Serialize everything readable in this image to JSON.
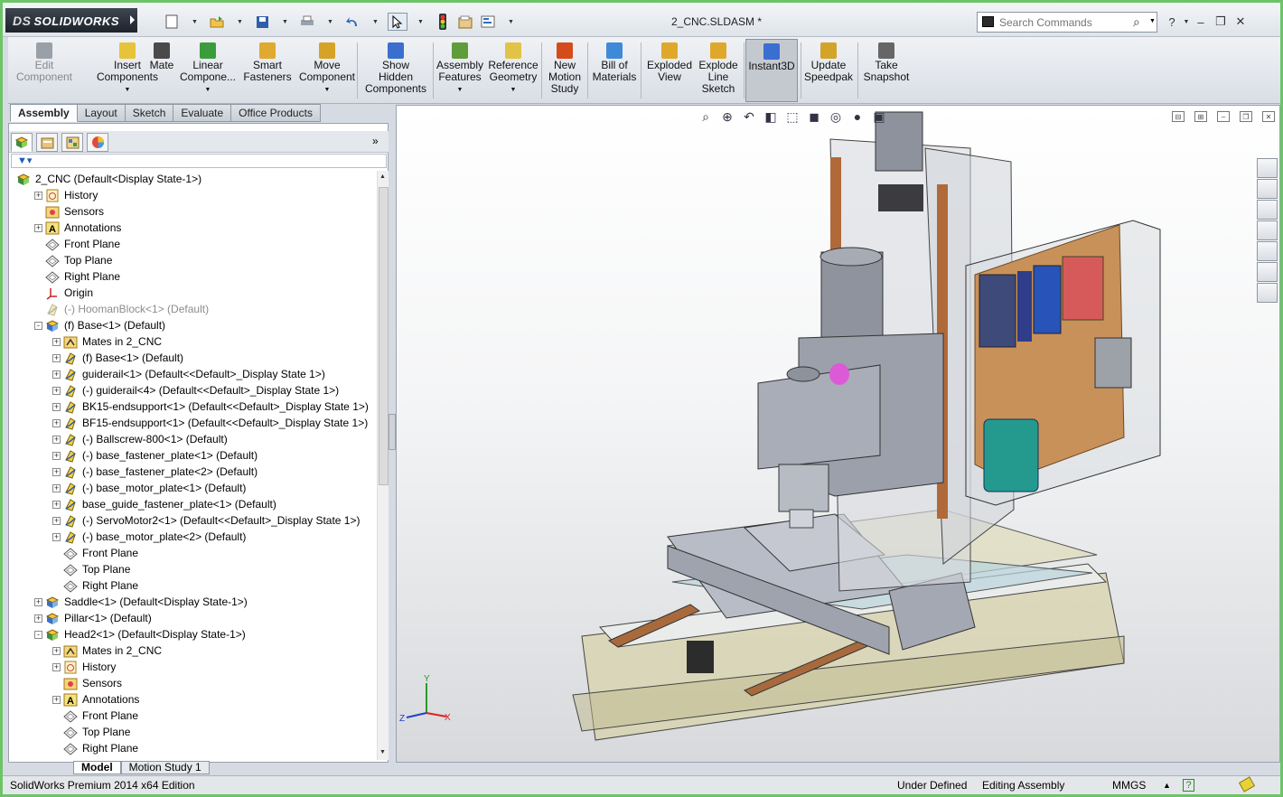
{
  "app": {
    "brand": "SOLIDWORKS",
    "doc_title": "2_CNC.SLDASM *"
  },
  "search": {
    "placeholder": "Search Commands"
  },
  "quick_access": [
    "new-icon",
    "open-icon",
    "save-icon",
    "print-icon",
    "undo-icon",
    "select-icon",
    "rebuild-icon",
    "file-properties-icon",
    "options-icon"
  ],
  "commands": [
    {
      "label": "Edit\nComponent",
      "icon": "edit-component-icon",
      "disabled": true
    },
    {
      "label": "Insert\nComponents",
      "icon": "insert-components-icon"
    },
    {
      "label": "Mate",
      "icon": "mate-icon"
    },
    {
      "label": "Linear\nCompone...",
      "icon": "linear-pattern-icon"
    },
    {
      "label": "Smart\nFasteners",
      "icon": "smart-fasteners-icon"
    },
    {
      "label": "Move\nComponent",
      "icon": "move-component-icon"
    },
    {
      "label": "Show\nHidden\nComponents",
      "icon": "show-hidden-icon"
    },
    {
      "label": "Assembly\nFeatures",
      "icon": "assembly-features-icon"
    },
    {
      "label": "Reference\nGeometry",
      "icon": "reference-geometry-icon"
    },
    {
      "label": "New\nMotion\nStudy",
      "icon": "motion-study-icon"
    },
    {
      "label": "Bill of\nMaterials",
      "icon": "bom-icon"
    },
    {
      "label": "Exploded\nView",
      "icon": "exploded-view-icon"
    },
    {
      "label": "Explode\nLine\nSketch",
      "icon": "explode-line-icon"
    },
    {
      "label": "Instant3D",
      "icon": "instant3d-icon",
      "active": true
    },
    {
      "label": "Update\nSpeedpak",
      "icon": "speedpak-icon"
    },
    {
      "label": "Take\nSnapshot",
      "icon": "snapshot-icon"
    }
  ],
  "cmd_tabs": [
    "Assembly",
    "Layout",
    "Sketch",
    "Evaluate",
    "Office Products"
  ],
  "tree": [
    {
      "label": "2_CNC  (Default<Display State-1>)",
      "level": 0,
      "exp": "",
      "icon": "assembly-icon"
    },
    {
      "label": "History",
      "level": 1,
      "exp": "+",
      "icon": "history-icon"
    },
    {
      "label": "Sensors",
      "level": 1,
      "exp": "",
      "icon": "sensors-icon"
    },
    {
      "label": "Annotations",
      "level": 1,
      "exp": "+",
      "icon": "annotations-icon"
    },
    {
      "label": "Front Plane",
      "level": 1,
      "exp": "",
      "icon": "plane-icon"
    },
    {
      "label": "Top Plane",
      "level": 1,
      "exp": "",
      "icon": "plane-icon"
    },
    {
      "label": "Right Plane",
      "level": 1,
      "exp": "",
      "icon": "plane-icon"
    },
    {
      "label": "Origin",
      "level": 1,
      "exp": "",
      "icon": "origin-icon"
    },
    {
      "label": "(-) HoomanBlock<1> (Default)",
      "level": 1,
      "exp": "",
      "icon": "part-icon",
      "dim": true
    },
    {
      "label": "(f) Base<1> (Default)",
      "level": 1,
      "exp": "-",
      "icon": "subassembly-icon"
    },
    {
      "label": "Mates in 2_CNC",
      "level": 2,
      "exp": "+",
      "icon": "mates-icon"
    },
    {
      "label": "(f) Base<1> (Default)",
      "level": 2,
      "exp": "+",
      "icon": "part-icon"
    },
    {
      "label": "guiderail<1> (Default<<Default>_Display State 1>)",
      "level": 2,
      "exp": "+",
      "icon": "part-icon"
    },
    {
      "label": "(-) guiderail<4> (Default<<Default>_Display State 1>)",
      "level": 2,
      "exp": "+",
      "icon": "part-icon"
    },
    {
      "label": "BK15-endsupport<1> (Default<<Default>_Display State 1>)",
      "level": 2,
      "exp": "+",
      "icon": "part-icon"
    },
    {
      "label": "BF15-endsupport<1> (Default<<Default>_Display State 1>)",
      "level": 2,
      "exp": "+",
      "icon": "part-icon"
    },
    {
      "label": "(-) Ballscrew-800<1> (Default)",
      "level": 2,
      "exp": "+",
      "icon": "part-icon"
    },
    {
      "label": "(-) base_fastener_plate<1> (Default)",
      "level": 2,
      "exp": "+",
      "icon": "part-icon"
    },
    {
      "label": "(-) base_fastener_plate<2> (Default)",
      "level": 2,
      "exp": "+",
      "icon": "part-icon"
    },
    {
      "label": "(-) base_motor_plate<1> (Default)",
      "level": 2,
      "exp": "+",
      "icon": "part-icon"
    },
    {
      "label": "base_guide_fastener_plate<1> (Default)",
      "level": 2,
      "exp": "+",
      "icon": "part-icon"
    },
    {
      "label": "(-) ServoMotor2<1> (Default<<Default>_Display State 1>)",
      "level": 2,
      "exp": "+",
      "icon": "part-icon"
    },
    {
      "label": "(-) base_motor_plate<2> (Default)",
      "level": 2,
      "exp": "+",
      "icon": "part-icon"
    },
    {
      "label": "Front Plane",
      "level": 2,
      "exp": "",
      "icon": "plane-icon"
    },
    {
      "label": "Top Plane",
      "level": 2,
      "exp": "",
      "icon": "plane-icon"
    },
    {
      "label": "Right Plane",
      "level": 2,
      "exp": "",
      "icon": "plane-icon"
    },
    {
      "label": "Saddle<1> (Default<Display State-1>)",
      "level": 1,
      "exp": "+",
      "icon": "subassembly-icon"
    },
    {
      "label": "Pillar<1> (Default)",
      "level": 1,
      "exp": "+",
      "icon": "subassembly-icon"
    },
    {
      "label": "Head2<1> (Default<Display State-1>)",
      "level": 1,
      "exp": "-",
      "icon": "assembly-icon"
    },
    {
      "label": "Mates in 2_CNC",
      "level": 2,
      "exp": "+",
      "icon": "mates-icon"
    },
    {
      "label": "History",
      "level": 2,
      "exp": "+",
      "icon": "history-icon"
    },
    {
      "label": "Sensors",
      "level": 2,
      "exp": "",
      "icon": "sensors-icon"
    },
    {
      "label": "Annotations",
      "level": 2,
      "exp": "+",
      "icon": "annotations-icon"
    },
    {
      "label": "Front Plane",
      "level": 2,
      "exp": "",
      "icon": "plane-icon"
    },
    {
      "label": "Top Plane",
      "level": 2,
      "exp": "",
      "icon": "plane-icon"
    },
    {
      "label": "Right Plane",
      "level": 2,
      "exp": "",
      "icon": "plane-icon"
    }
  ],
  "bottom_tabs": [
    "Model",
    "Motion Study 1"
  ],
  "status": {
    "edition": "SolidWorks Premium 2014 x64 Edition",
    "state": "Under Defined",
    "mode": "Editing Assembly",
    "units": "MMGS",
    "units_arrow": "▲",
    "help": "?"
  },
  "triad": {
    "x": "X",
    "y": "Y",
    "z": "Z"
  },
  "colors": {
    "accent_border": "#6cc466",
    "titlebar_bg": "#dfe4ea",
    "brand_bg": "#1d232b"
  }
}
